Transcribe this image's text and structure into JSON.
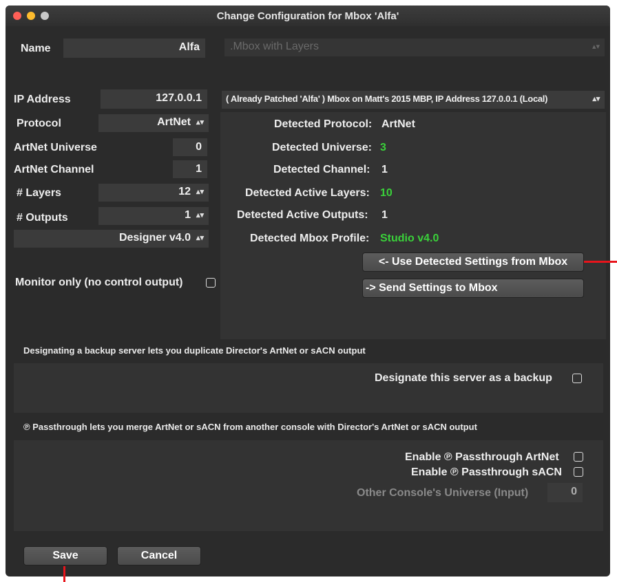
{
  "window": {
    "title": "Change Configuration for Mbox 'Alfa'"
  },
  "name": {
    "label": "Name",
    "value": "Alfa",
    "type_placeholder": ".Mbox with Layers"
  },
  "ip": {
    "label": "IP Address",
    "value": "127.0.0.1",
    "patched_selection": "( Already Patched 'Alfa' ) Mbox on Matt's 2015 MBP, IP Address 127.0.0.1 (Local)"
  },
  "protocol": {
    "label": "Protocol",
    "value": "ArtNet"
  },
  "universe": {
    "label": "ArtNet Universe",
    "value": "0"
  },
  "channel": {
    "label": "ArtNet Channel",
    "value": "1"
  },
  "layers": {
    "label": "# Layers",
    "value": "12"
  },
  "outputs": {
    "label": "# Outputs",
    "value": "1"
  },
  "profile": {
    "value": "Designer v4.0"
  },
  "monitor": {
    "label": "Monitor only (no control output)",
    "checked": false
  },
  "detected": {
    "protocol_label": "Detected Protocol:",
    "protocol_value": "ArtNet",
    "universe_label": "Detected Universe:",
    "universe_value": "3",
    "channel_label": "Detected Channel:",
    "channel_value": "1",
    "layers_label": "Detected Active Layers:",
    "layers_value": "10",
    "outputs_label": "Detected Active Outputs:",
    "outputs_value": "1",
    "profile_label": "Detected Mbox Profile:",
    "profile_value": "Studio v4.0"
  },
  "actions": {
    "use_detected": "<- Use Detected Settings from Mbox",
    "send_settings": "-> Send Settings to Mbox"
  },
  "backup": {
    "note": "Designating a backup server lets you duplicate Director's ArtNet or sACN output",
    "label": "Designate this server as a backup",
    "checked": false
  },
  "passthrough": {
    "note": "℗ Passthrough lets you merge ArtNet or sACN from another console with Director's ArtNet or sACN output",
    "artnet_label": "Enable ℗ Passthrough ArtNet",
    "sacn_label": "Enable ℗ Passthrough sACN",
    "universe_label": "Other Console's Universe (Input)",
    "universe_value": "0"
  },
  "footer": {
    "save": "Save",
    "cancel": "Cancel"
  },
  "colors": {
    "highlight_green": "#3ad13a",
    "marker_red": "#e8141b"
  }
}
